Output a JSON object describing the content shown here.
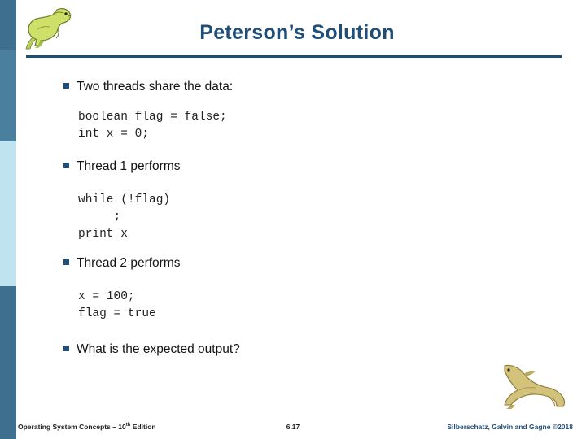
{
  "slide": {
    "title": "Peterson’s Solution",
    "blocks": [
      {
        "kind": "bullet",
        "text": "Two threads share the data:"
      },
      {
        "kind": "code",
        "text": "boolean flag = false;\nint x = 0;"
      },
      {
        "kind": "bullet",
        "text": "Thread 1 performs"
      },
      {
        "kind": "code",
        "text": "while (!flag)\n     ;\nprint x"
      },
      {
        "kind": "bullet",
        "text": "Thread 2 performs"
      },
      {
        "kind": "code",
        "text": "x = 100;\nflag = true"
      },
      {
        "kind": "bullet",
        "text": "What is the expected output?"
      }
    ]
  },
  "footer": {
    "left_main": "Operating System Concepts – 10",
    "left_sup": "th",
    "left_tail": " Edition",
    "center": "6.17",
    "right": "Silberschatz, Galvin and Gagne ©2018"
  },
  "icons": {
    "top_logo": "dinosaur-logo-icon",
    "bottom_logo": "dinosaur-logo-icon"
  },
  "colors": {
    "accent": "#1f4e79",
    "bar_dark": "#3f6f8e",
    "bar_light": "#bfe3ef"
  }
}
